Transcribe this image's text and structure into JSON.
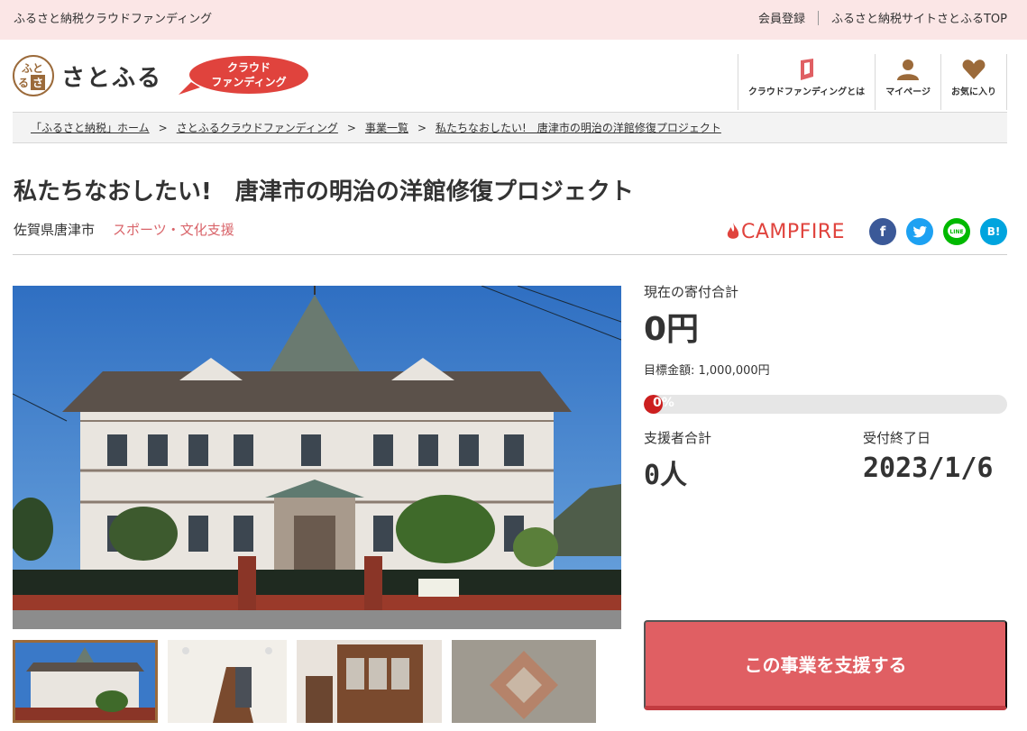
{
  "topbar": {
    "site_name": "ふるさと納税クラウドファンディング",
    "register": "会員登録",
    "top_link": "ふるさと納税サイトさとふるTOP"
  },
  "header": {
    "logo_text": "さとふる",
    "logo_mark": [
      "ふ",
      "る",
      "さ",
      "と"
    ],
    "cf_badge": [
      "クラウド",
      "ファンディング"
    ],
    "nav": [
      {
        "label": "クラウドファンディングとは",
        "icon": "book-icon"
      },
      {
        "label": "マイページ",
        "icon": "user-icon"
      },
      {
        "label": "お気に入り",
        "icon": "heart-icon"
      }
    ],
    "colors": {
      "brand_brown": "#9b6a3a",
      "accent_red": "#e0433d"
    }
  },
  "breadcrumb": {
    "items": [
      "「ふるさと納税」ホーム",
      "さとふるクラウドファンディング",
      "事業一覧",
      "私たちなおしたい!　唐津市の明治の洋館修復プロジェクト"
    ],
    "separator": ">"
  },
  "project": {
    "title": "私たちなおしたい!　唐津市の明治の洋館修復プロジェクト",
    "prefecture": "佐賀県唐津市",
    "category": "スポーツ・文化支援",
    "partner": "CAMPFIRE",
    "social": [
      {
        "name": "facebook",
        "label": "f",
        "color": "#3b5998"
      },
      {
        "name": "twitter",
        "label": "",
        "color": "#1da1f2"
      },
      {
        "name": "line",
        "label": "LINE",
        "color": "#00b900"
      },
      {
        "name": "hatena",
        "label": "B!",
        "color": "#00a4de"
      }
    ]
  },
  "stats": {
    "total_label": "現在の寄付合計",
    "total_amount": "0円",
    "goal_label": "目標金額: 1,000,000円",
    "progress_text": "0%",
    "progress_value": 0,
    "supporters_label": "支援者合計",
    "supporters": "0人",
    "deadline_label": "受付終了日",
    "deadline": "2023/1/6"
  },
  "cta": {
    "label": "この事業を支援する",
    "color": "#e05f63"
  }
}
